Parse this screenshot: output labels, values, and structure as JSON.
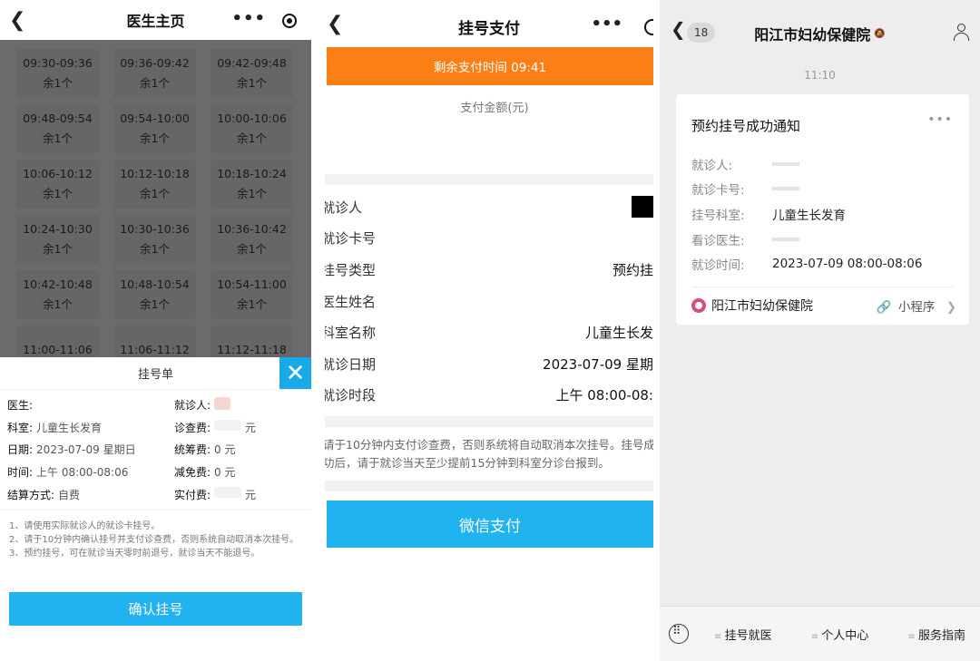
{
  "doctor_page": {
    "title": "医生主页",
    "slots": [
      {
        "time": "09:30-09:36",
        "remain": "余1个"
      },
      {
        "time": "09:36-09:42",
        "remain": "余1个"
      },
      {
        "time": "09:42-09:48",
        "remain": "余1个"
      },
      {
        "time": "09:48-09:54",
        "remain": "余1个"
      },
      {
        "time": "09:54-10:00",
        "remain": "余1个"
      },
      {
        "time": "10:00-10:06",
        "remain": "余1个"
      },
      {
        "time": "10:06-10:12",
        "remain": "余1个"
      },
      {
        "time": "10:12-10:18",
        "remain": "余1个"
      },
      {
        "time": "10:18-10:24",
        "remain": "余1个"
      },
      {
        "time": "10:24-10:30",
        "remain": "余1个"
      },
      {
        "time": "10:30-10:36",
        "remain": "余1个"
      },
      {
        "time": "10:36-10:42",
        "remain": "余1个"
      },
      {
        "time": "10:42-10:48",
        "remain": "余1个"
      },
      {
        "time": "10:48-10:54",
        "remain": "余1个"
      },
      {
        "time": "10:54-11:00",
        "remain": "余1个"
      },
      {
        "time": "11:00-11:06",
        "remain": ""
      },
      {
        "time": "11:06-11:12",
        "remain": ""
      },
      {
        "time": "11:12-11:18",
        "remain": ""
      }
    ],
    "sheet": {
      "title": "挂号单",
      "doctor_label": "医生:",
      "patient_label": "就诊人:",
      "dept_label": "科室:",
      "dept_value": "儿童生长发育",
      "fee_label": "诊查费:",
      "fee_unit": "元",
      "date_label": "日期:",
      "date_value": "2023-07-09 星期日",
      "pool_label": "统筹费:",
      "pool_value": "0 元",
      "time_label": "时间:",
      "time_value": "上午 08:00-08:06",
      "discount_label": "减免费:",
      "discount_value": "0 元",
      "settle_label": "结算方式:",
      "settle_value": "自费",
      "paid_label": "实付费:",
      "paid_unit": "元",
      "note1": "1、请使用实际就诊人的就诊卡挂号。",
      "note2": "2、请于10分钟内确认挂号并支付诊查费，否则系统自动取消本次挂号。",
      "note3": "3、预约挂号，可在就诊当天零时前退号，就诊当天不能退号。",
      "confirm_label": "确认挂号"
    }
  },
  "payment_page": {
    "title": "挂号支付",
    "timer": "剩余支付时间 09:41",
    "amount_label": "支付金额(元)",
    "rows": [
      {
        "k": "就诊人",
        "v": ""
      },
      {
        "k": "就诊卡号",
        "v": ""
      },
      {
        "k": "挂号类型",
        "v": "预约挂"
      },
      {
        "k": "医生姓名",
        "v": ""
      },
      {
        "k": "科室名称",
        "v": "儿童生长发"
      },
      {
        "k": "就诊日期",
        "v": "2023-07-09 星期"
      },
      {
        "k": "就诊时段",
        "v": "上午 08:00-08:"
      }
    ],
    "desc": "请于10分钟内支付诊查费，否则系统将自动取消本次挂号。挂号成功后，请于就诊当天至少提前15分钟到科室分诊台报到。",
    "pay_label": "微信支付"
  },
  "chat_page": {
    "unread": "18",
    "title": "阳江市妇幼保健院",
    "time": "11:10",
    "card": {
      "title": "预约挂号成功通知",
      "fields": [
        {
          "k": "就诊人:",
          "v": ""
        },
        {
          "k": "就诊卡号:",
          "v": ""
        },
        {
          "k": "挂号科室:",
          "v": "儿童生长发育"
        },
        {
          "k": "看诊医生:",
          "v": ""
        },
        {
          "k": "就诊时间:",
          "v": "2023-07-09 08:00-08:06"
        }
      ],
      "source": "阳江市妇幼保健院",
      "miniapp": "小程序"
    },
    "menu": [
      "挂号就医",
      "个人中心",
      "服务指南"
    ]
  }
}
